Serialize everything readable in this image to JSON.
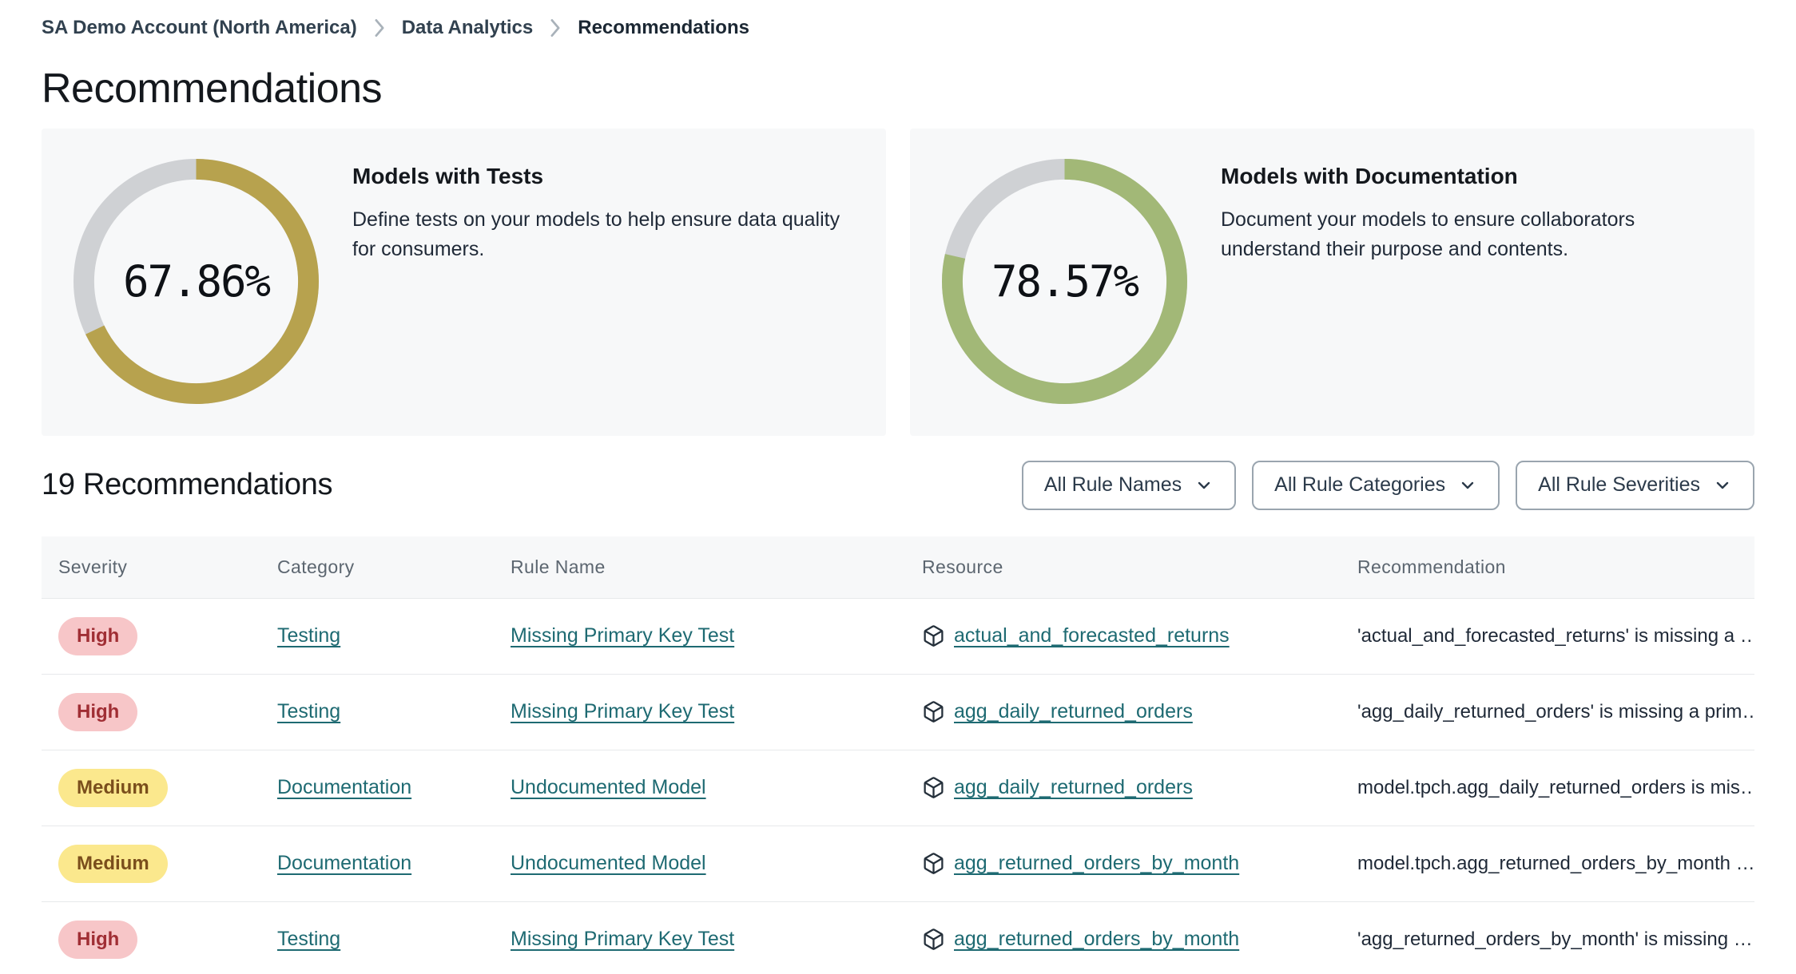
{
  "breadcrumb": {
    "items": [
      {
        "label": "SA Demo Account (North America)"
      },
      {
        "label": "Data Analytics"
      },
      {
        "label": "Recommendations"
      }
    ]
  },
  "page_title": "Recommendations",
  "cards": [
    {
      "title": "Models with Tests",
      "description": "Define tests on your models to help ensure data quality for consumers.",
      "percent_label": "67.86%",
      "percent_value": 67.86,
      "ring_color": "#B7A24E"
    },
    {
      "title": "Models with Documentation",
      "description": "Document your models to ensure collaborators understand their purpose and contents.",
      "percent_label": "78.57%",
      "percent_value": 78.57,
      "ring_color": "#A2B877"
    }
  ],
  "recommendations_header": {
    "title": "19 Recommendations",
    "filters": [
      {
        "label": "All Rule Names"
      },
      {
        "label": "All Rule Categories"
      },
      {
        "label": "All Rule Severities"
      }
    ]
  },
  "table": {
    "columns": [
      "Severity",
      "Category",
      "Rule Name",
      "Resource",
      "Recommendation"
    ],
    "rows": [
      {
        "severity": "High",
        "severity_level": "high",
        "category": "Testing",
        "rule_name": "Missing Primary Key Test",
        "resource": "actual_and_forecasted_returns",
        "recommendation": "'actual_and_forecasted_returns' is missing a …"
      },
      {
        "severity": "High",
        "severity_level": "high",
        "category": "Testing",
        "rule_name": "Missing Primary Key Test",
        "resource": "agg_daily_returned_orders",
        "recommendation": "'agg_daily_returned_orders' is missing a prim…"
      },
      {
        "severity": "Medium",
        "severity_level": "medium",
        "category": "Documentation",
        "rule_name": "Undocumented Model",
        "resource": "agg_daily_returned_orders",
        "recommendation": "model.tpch.agg_daily_returned_orders is mis…"
      },
      {
        "severity": "Medium",
        "severity_level": "medium",
        "category": "Documentation",
        "rule_name": "Undocumented Model",
        "resource": "agg_returned_orders_by_month",
        "recommendation": "model.tpch.agg_returned_orders_by_month …"
      },
      {
        "severity": "High",
        "severity_level": "high",
        "category": "Testing",
        "rule_name": "Missing Primary Key Test",
        "resource": "agg_returned_orders_by_month",
        "recommendation": "'agg_returned_orders_by_month' is missing …"
      }
    ]
  },
  "colors": {
    "link": "#1E6A72",
    "card_background": "#F7F8F9",
    "donut_track": "#CFD1D4",
    "severity_high_bg": "#F7C6C8",
    "severity_high_text": "#A02E34",
    "severity_medium_bg": "#FBE88D",
    "severity_medium_text": "#7A4E1C"
  },
  "chart_data": [
    {
      "type": "donut",
      "title": "Models with Tests",
      "value": 67.86,
      "unit": "%",
      "label": "67.86%",
      "color": "#B7A24E",
      "track_color": "#CFD1D4",
      "start_angle": "top",
      "direction": "clockwise"
    },
    {
      "type": "donut",
      "title": "Models with Documentation",
      "value": 78.57,
      "unit": "%",
      "label": "78.57%",
      "color": "#A2B877",
      "track_color": "#CFD1D4",
      "start_angle": "top",
      "direction": "clockwise"
    }
  ]
}
